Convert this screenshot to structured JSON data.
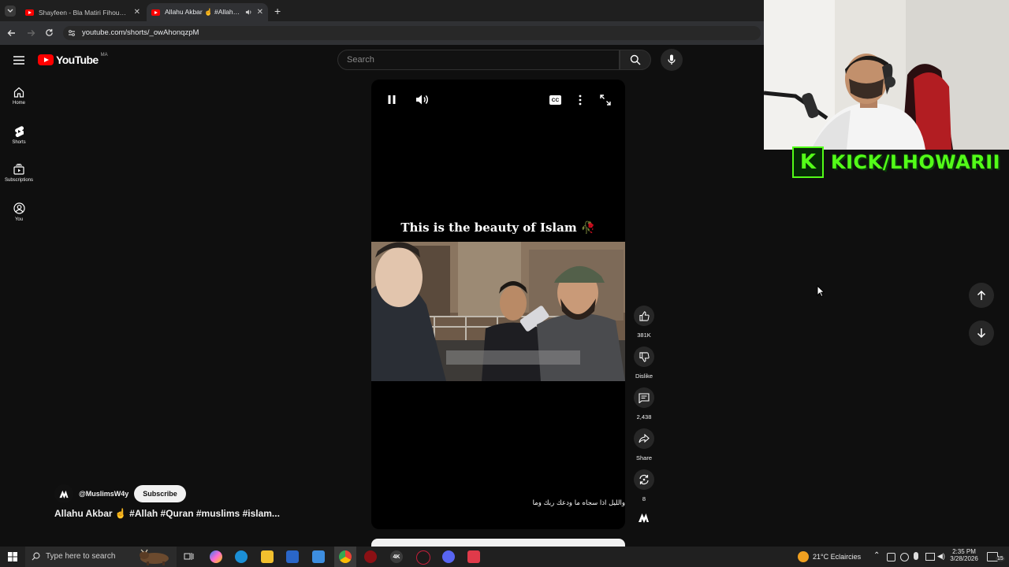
{
  "browser": {
    "tabs": [
      {
        "title": "Shayfeen - Bla Matiri Fihoum (I...",
        "active": false
      },
      {
        "title": "Allahu Akbar ☝️ #Allah #Qu...",
        "active": true
      }
    ],
    "new_tab_symbol": "+",
    "address": "youtube.com/shorts/_owAhonqzpM"
  },
  "youtube": {
    "logo_text": "YouTube",
    "country_code": "MA",
    "search_placeholder": "Search",
    "sidebar": [
      {
        "label": "Home",
        "icon": "home-icon"
      },
      {
        "label": "Shorts",
        "icon": "shorts-icon"
      },
      {
        "label": "Subscriptions",
        "icon": "subscriptions-icon"
      },
      {
        "label": "You",
        "icon": "you-icon"
      }
    ],
    "player": {
      "caption": "This is the beauty of Islam 🥀",
      "arabic_subtitle": "والليل اذا سجاه ما ودعك ربك وما",
      "cc_label": "CC"
    },
    "actions": {
      "likes": "381K",
      "dislike_label": "Dislike",
      "comments": "2,438",
      "share_label": "Share",
      "remix_count": "8"
    },
    "channel": {
      "handle": "@MuslimsW4y",
      "subscribe_label": "Subscribe"
    },
    "short_title": "Allahu Akbar ☝️ #Allah #Quran #muslims #islam..."
  },
  "overlay": {
    "kick_text": "KICK/LHOWARII",
    "kick_letter": "K"
  },
  "taskbar": {
    "search_placeholder": "Type here to search",
    "weather": "21°C  Eclaircies",
    "time": "2:35 PM",
    "date": "3/28/2026",
    "notification_count": "15"
  },
  "colors": {
    "youtube_red": "#ff0000",
    "kick_green": "#53fc18",
    "page_bg": "#0f0f0f"
  }
}
